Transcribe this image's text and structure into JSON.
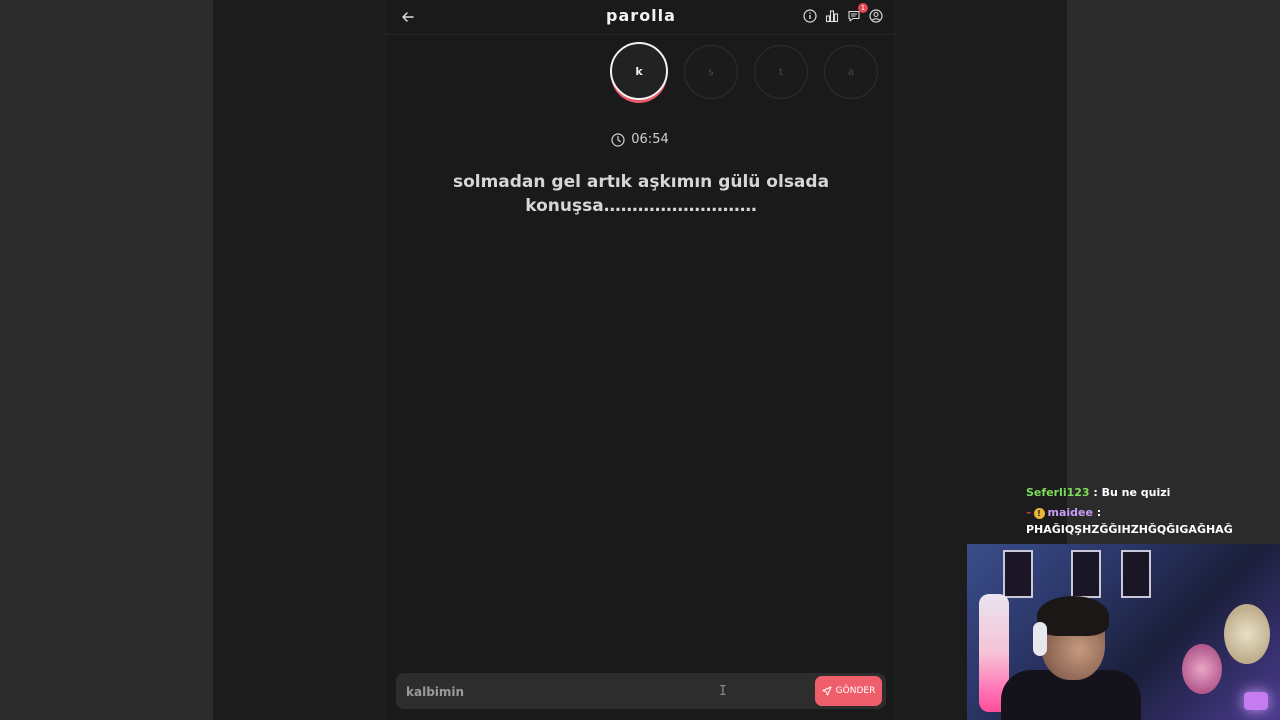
{
  "app": {
    "title": "parolla",
    "notification_count": "1"
  },
  "letters": [
    {
      "char": "k",
      "active": true
    },
    {
      "char": "s",
      "active": false
    },
    {
      "char": "t",
      "active": false
    },
    {
      "char": "a",
      "active": false
    }
  ],
  "timer": {
    "value": "06:54"
  },
  "question": {
    "line1": "solmadan gel artık aşkımın gülü olsada",
    "line2": "konuşsa………………………"
  },
  "answer": {
    "value": "kalbimin",
    "send_label": "GÖNDER"
  },
  "chat": {
    "messages": [
      {
        "user": "Seferli123",
        "text": " : Bu ne quizi"
      },
      {
        "user": "maidee",
        "text": " :",
        "continuation": "PHAĞIQŞHZĞĞIHZHĞQĞIGAĞHAĞ",
        "badge": "!"
      }
    ]
  },
  "colors": {
    "accent": "#ef5f6b",
    "background": "#1a1a1a",
    "chat_user_1": "#7cde59",
    "chat_user_2": "#c99cf5"
  },
  "icons": [
    "arrow-left-icon",
    "info-icon",
    "chart-icon",
    "chat-icon",
    "user-circle-icon",
    "clock-icon",
    "send-icon"
  ]
}
